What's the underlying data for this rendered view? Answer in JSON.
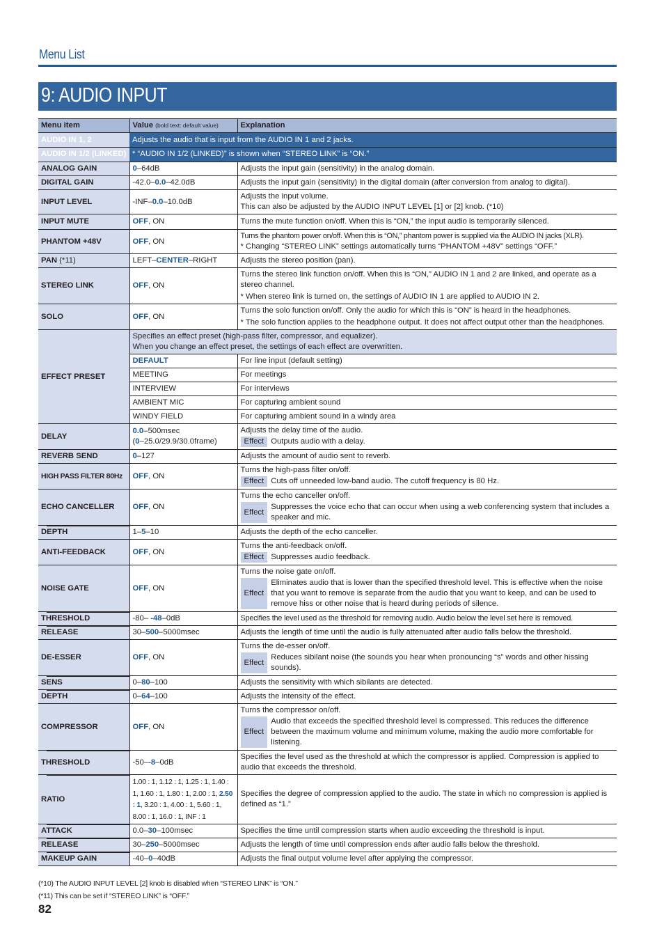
{
  "page": {
    "section": "Menu List",
    "title": "9: AUDIO INPUT",
    "page_number": "82"
  },
  "table": {
    "headers": {
      "menu_item": "Menu item",
      "value": "Value",
      "value_note": "(bold text: default value)",
      "explanation": "Explanation"
    },
    "group": {
      "name1": "AUDIO IN 1, 2",
      "name2": "AUDIO IN 1/2 (LINKED)",
      "desc1": "Adjusts the audio that is input from the AUDIO IN 1 and 2 jacks.",
      "desc2": "* “AUDIO IN 1/2 (LINKED)” is shown when “STEREO LINK” is “ON.”"
    },
    "effect_label": "Effect",
    "rows": {
      "analog_gain": {
        "name": "ANALOG GAIN",
        "v_default": "0",
        "v_post": "–64dB",
        "exp": "Adjusts the input gain (sensitivity) in the analog domain."
      },
      "digital_gain": {
        "name": "DIGITAL GAIN",
        "v_pre": "-42.0–",
        "v_default": "0.0",
        "v_post": "–42.0dB",
        "exp": "Adjusts the input gain (sensitivity) in the digital domain (after conversion from analog to digital)."
      },
      "input_level": {
        "name": "INPUT LEVEL",
        "v_pre": "-INF–",
        "v_default": "0.0",
        "v_post": "–10.0dB",
        "exp1": "Adjusts the input volume.",
        "exp2": "This can also be adjusted by the AUDIO INPUT LEVEL [1] or [2] knob. (*10)"
      },
      "input_mute": {
        "name": "INPUT MUTE",
        "v_default": "OFF",
        "v_post": ", ON",
        "exp": "Turns the mute function on/off. When this is “ON,” the input audio is temporarily silenced."
      },
      "phantom": {
        "name": "PHANTOM +48V",
        "v_default": "OFF",
        "v_post": ", ON",
        "exp1": "Turns the phantom power on/off. When this is “ON,” phantom power is supplied via the AUDIO IN jacks (XLR).",
        "exp2": "* Changing “STEREO LINK” settings automatically turns “PHANTOM +48V” settings “OFF.”"
      },
      "pan": {
        "name": "PAN",
        "name_note": "(*11)",
        "v_pre": "LEFT–",
        "v_default": "CENTER",
        "v_post": "–RIGHT",
        "exp": "Adjusts the stereo position (pan)."
      },
      "stereo_link": {
        "name": "STEREO LINK",
        "v_default": "OFF",
        "v_post": ", ON",
        "exp1": "Turns the stereo link function on/off. When this is “ON,” AUDIO IN 1 and 2 are linked, and operate as a stereo channel.",
        "exp2": "* When stereo link is turned on, the settings of AUDIO IN 1 are applied to AUDIO IN 2."
      },
      "solo": {
        "name": "SOLO",
        "v_default": "OFF",
        "v_post": ", ON",
        "exp1": "Turns the solo function on/off. Only the audio for which this is “ON” is heard in the headphones.",
        "exp2": "* The solo function applies to the headphone output. It does not affect output other than the headphones."
      },
      "effect_preset": {
        "name": "EFFECT PRESET",
        "desc1": "Specifies an effect preset (high-pass filter, compressor, and equalizer).",
        "desc2": "When you change an effect preset, the settings of each effect are overwritten.",
        "options": [
          {
            "value": "DEFAULT",
            "exp": "For line input (default setting)",
            "default": true
          },
          {
            "value": "MEETING",
            "exp": "For meetings"
          },
          {
            "value": "INTERVIEW",
            "exp": "For interviews"
          },
          {
            "value": "AMBIENT MIC",
            "exp": "For capturing ambient sound"
          },
          {
            "value": "WINDY FIELD",
            "exp": "For capturing ambient sound in a windy area"
          }
        ]
      },
      "delay": {
        "name": "DELAY",
        "v_default": "0.0",
        "v_post": "–500msec",
        "v2_pre": "(",
        "v2_default": "0",
        "v2_post": "–25.0/29.9/30.0frame)",
        "exp": "Adjusts the delay time of the audio.",
        "effect": "Outputs audio with a delay."
      },
      "reverb_send": {
        "name": "REVERB SEND",
        "v_default": "0",
        "v_post": "–127",
        "exp": "Adjusts the amount of audio sent to reverb."
      },
      "hpf": {
        "name": "HIGH PASS FILTER 80Hz",
        "v_default": "OFF",
        "v_post": ", ON",
        "exp": "Turns the high-pass filter on/off.",
        "effect": "Cuts off unneeded low-band audio. The cutoff frequency is 80 Hz."
      },
      "echo_canceller": {
        "name": "ECHO CANCELLER",
        "v_default": "OFF",
        "v_post": ", ON",
        "exp": "Turns the echo canceller on/off.",
        "effect": "Suppresses the voice echo that can occur when using a web conferencing system that includes a speaker and mic."
      },
      "echo_depth": {
        "name": "DEPTH",
        "v_pre": "1–",
        "v_default": "5",
        "v_post": "–10",
        "exp": "Adjusts the depth of the echo canceller."
      },
      "anti_feedback": {
        "name": "ANTI-FEEDBACK",
        "v_default": "OFF",
        "v_post": ", ON",
        "exp": "Turns the anti-feedback on/off.",
        "effect": "Suppresses audio feedback."
      },
      "noise_gate": {
        "name": "NOISE GATE",
        "v_default": "OFF",
        "v_post": ", ON",
        "exp": "Turns the noise gate on/off.",
        "effect": "Eliminates audio that is lower than the specified threshold level. This is effective when the noise that you want to remove is separate from the audio that you want to keep, and can be used to remove hiss or other noise that is heard during periods of silence."
      },
      "ng_threshold": {
        "name": "THRESHOLD",
        "v_pre": "-80– ",
        "v_default": "-48",
        "v_post": "–0dB",
        "exp": "Specifies the level used as the threshold for removing audio. Audio below the level set here is removed."
      },
      "ng_release": {
        "name": "RELEASE",
        "v_pre": "30–",
        "v_default": "500",
        "v_post": "–5000msec",
        "exp": "Adjusts the length of time until the audio is fully attenuated after audio falls below the threshold."
      },
      "de_esser": {
        "name": "DE-ESSER",
        "v_default": "OFF",
        "v_post": ", ON",
        "exp": "Turns the de-esser on/off.",
        "effect": "Reduces sibilant noise (the sounds you hear when pronouncing “s” words and other hissing sounds)."
      },
      "de_sens": {
        "name": "SENS",
        "v_pre": "0–",
        "v_default": "80",
        "v_post": "–100",
        "exp": "Adjusts the sensitivity with which sibilants are detected."
      },
      "de_depth": {
        "name": "DEPTH",
        "v_pre": "0–",
        "v_default": "64",
        "v_post": "–100",
        "exp": "Adjusts the intensity of the effect."
      },
      "compressor": {
        "name": "COMPRESSOR",
        "v_default": "OFF",
        "v_post": ", ON",
        "exp": "Turns the compressor on/off.",
        "effect": "Audio that exceeds the specified threshold level is compressed. This reduces the difference between the maximum volume and minimum volume, making the audio more comfortable for listening."
      },
      "comp_threshold": {
        "name": "THRESHOLD",
        "v_pre": "-50–",
        "v_default": "-8",
        "v_post": "–0dB",
        "exp": "Specifies the level used as the threshold at which the compressor is applied. Compression is applied to audio that exceeds the threshold."
      },
      "comp_ratio": {
        "name": "RATIO",
        "v_pre": "1.00 : 1, 1.12 : 1, 1.25 : 1, 1.40 : 1, 1.60 : 1, 1.80 : 1, 2.00 : 1, ",
        "v_default": "2.50 : 1",
        "v_post": ", 3.20 : 1, 4.00 : 1, 5.60 : 1, 8.00 : 1, 16.0 : 1, INF : 1",
        "exp": "Specifies the degree of compression applied to the audio. The state in which no compression is applied is defined as “1.”"
      },
      "comp_attack": {
        "name": "ATTACK",
        "v_pre": "0.0–",
        "v_default": "30",
        "v_post": "–100msec",
        "exp": "Specifies the time until compression starts when audio exceeding the threshold is input."
      },
      "comp_release": {
        "name": "RELEASE",
        "v_pre": "30–",
        "v_default": "250",
        "v_post": "–5000msec",
        "exp": "Adjusts the length of time until compression ends after audio falls below the threshold."
      },
      "comp_makeup": {
        "name": "MAKEUP GAIN",
        "v_pre": "-40–",
        "v_default": "0",
        "v_post": "–40dB",
        "exp": "Adjusts the final output volume level after applying the compressor."
      }
    }
  },
  "footnotes": [
    "(*10) The AUDIO INPUT LEVEL [2] knob is disabled when “STEREO LINK” is “ON.”",
    "(*11) This can be set if “STEREO LINK” is “OFF.”"
  ],
  "colors": {
    "accent_blue": "#1f5a96",
    "title_bar": "#33659f",
    "header_row": "#a9bad9",
    "name_cell": "#d4dced",
    "effect_badge": "#c5d0e6"
  }
}
